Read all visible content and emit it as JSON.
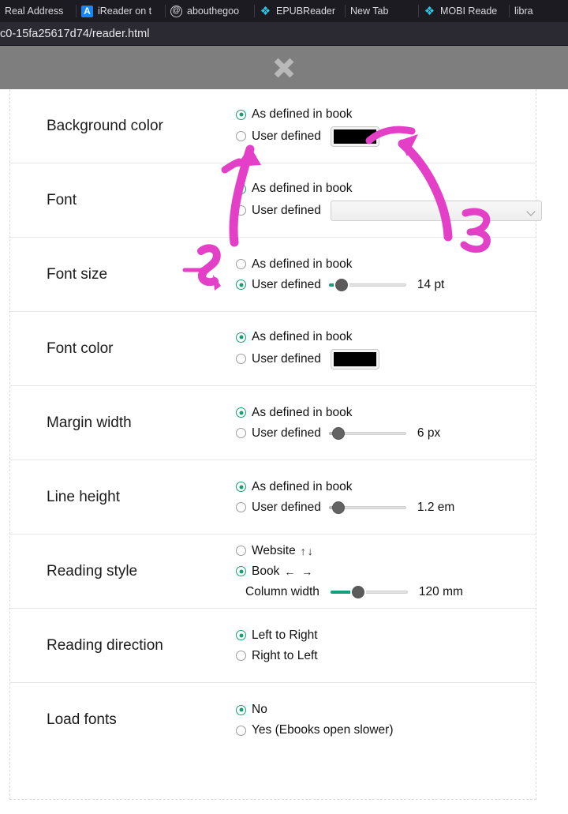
{
  "browser": {
    "tabs": [
      {
        "label": "Real Address",
        "favicon": "none-icon"
      },
      {
        "label": "iReader on t",
        "favicon": "appstore-icon"
      },
      {
        "label": "abouthegoo",
        "favicon": "at-circle-icon"
      },
      {
        "label": "EPUBReader",
        "favicon": "puzzle-icon"
      },
      {
        "label": "New Tab",
        "favicon": "none-icon"
      },
      {
        "label": "MOBI Reade",
        "favicon": "puzzle-icon"
      },
      {
        "label": "libra",
        "favicon": "none-icon"
      }
    ],
    "url": "c0-15fa25617d74/reader.html"
  },
  "dialog": {
    "close_label": "close-icon"
  },
  "settings": {
    "rows": [
      {
        "label": "Background color",
        "options": [
          {
            "text": "As defined in book",
            "selected": true
          },
          {
            "text": "User defined",
            "selected": false
          }
        ],
        "control": "color",
        "color_value": "#000000"
      },
      {
        "label": "Font",
        "options": [
          {
            "text": "As defined in book",
            "selected": true
          },
          {
            "text": "User defined",
            "selected": false
          }
        ],
        "control": "select",
        "select_value": ""
      },
      {
        "label": "Font size",
        "options": [
          {
            "text": "As defined in book",
            "selected": false
          },
          {
            "text": "User defined",
            "selected": true
          }
        ],
        "control": "slider",
        "slider_value": "14 pt",
        "slider_pct": 16,
        "slider_active": true
      },
      {
        "label": "Font color",
        "options": [
          {
            "text": "As defined in book",
            "selected": true
          },
          {
            "text": "User defined",
            "selected": false
          }
        ],
        "control": "color",
        "color_value": "#000000"
      },
      {
        "label": "Margin width",
        "options": [
          {
            "text": "As defined in book",
            "selected": true
          },
          {
            "text": "User defined",
            "selected": false
          }
        ],
        "control": "slider",
        "slider_value": "6 px",
        "slider_pct": 12,
        "slider_active": false
      },
      {
        "label": "Line height",
        "options": [
          {
            "text": "As defined in book",
            "selected": true
          },
          {
            "text": "User defined",
            "selected": false
          }
        ],
        "control": "slider",
        "slider_value": "1.2 em",
        "slider_pct": 12,
        "slider_active": false
      },
      {
        "label": "Reading style",
        "options": [
          {
            "text": "Website",
            "selected": false,
            "arrows": "↑↓"
          },
          {
            "text": "Book",
            "selected": true,
            "arrows": "← →"
          }
        ],
        "control": "sub-slider",
        "sub_label": "Column width",
        "slider_value": "120 mm",
        "slider_pct": 36,
        "slider_active": true
      },
      {
        "label": "Reading direction",
        "options": [
          {
            "text": "Left to Right",
            "selected": true
          },
          {
            "text": "Right to Left",
            "selected": false
          }
        ],
        "control": "none"
      },
      {
        "label": "Load fonts",
        "options": [
          {
            "text": "No",
            "selected": true
          },
          {
            "text": "Yes (Ebooks open slower)",
            "selected": false
          }
        ],
        "control": "none"
      }
    ]
  },
  "annotations": {
    "color": "#e33fc7",
    "marks": [
      {
        "id": "1",
        "label": "1",
        "target": "background-user-defined-radio"
      },
      {
        "id": "2",
        "label": "2",
        "target": "font-size-user-defined-radio"
      },
      {
        "id": "3",
        "label": "3",
        "target": "background-color-swatch"
      }
    ]
  }
}
